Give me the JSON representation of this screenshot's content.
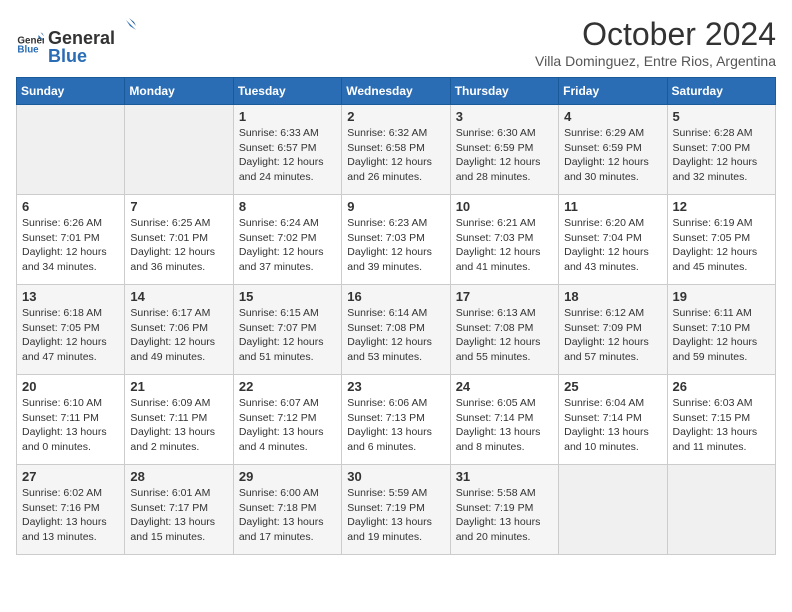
{
  "header": {
    "logo_general": "General",
    "logo_blue": "Blue",
    "month_year": "October 2024",
    "location": "Villa Dominguez, Entre Rios, Argentina"
  },
  "weekdays": [
    "Sunday",
    "Monday",
    "Tuesday",
    "Wednesday",
    "Thursday",
    "Friday",
    "Saturday"
  ],
  "weeks": [
    [
      {
        "day": "",
        "info": ""
      },
      {
        "day": "",
        "info": ""
      },
      {
        "day": "1",
        "info": "Sunrise: 6:33 AM\nSunset: 6:57 PM\nDaylight: 12 hours and 24 minutes."
      },
      {
        "day": "2",
        "info": "Sunrise: 6:32 AM\nSunset: 6:58 PM\nDaylight: 12 hours and 26 minutes."
      },
      {
        "day": "3",
        "info": "Sunrise: 6:30 AM\nSunset: 6:59 PM\nDaylight: 12 hours and 28 minutes."
      },
      {
        "day": "4",
        "info": "Sunrise: 6:29 AM\nSunset: 6:59 PM\nDaylight: 12 hours and 30 minutes."
      },
      {
        "day": "5",
        "info": "Sunrise: 6:28 AM\nSunset: 7:00 PM\nDaylight: 12 hours and 32 minutes."
      }
    ],
    [
      {
        "day": "6",
        "info": "Sunrise: 6:26 AM\nSunset: 7:01 PM\nDaylight: 12 hours and 34 minutes."
      },
      {
        "day": "7",
        "info": "Sunrise: 6:25 AM\nSunset: 7:01 PM\nDaylight: 12 hours and 36 minutes."
      },
      {
        "day": "8",
        "info": "Sunrise: 6:24 AM\nSunset: 7:02 PM\nDaylight: 12 hours and 37 minutes."
      },
      {
        "day": "9",
        "info": "Sunrise: 6:23 AM\nSunset: 7:03 PM\nDaylight: 12 hours and 39 minutes."
      },
      {
        "day": "10",
        "info": "Sunrise: 6:21 AM\nSunset: 7:03 PM\nDaylight: 12 hours and 41 minutes."
      },
      {
        "day": "11",
        "info": "Sunrise: 6:20 AM\nSunset: 7:04 PM\nDaylight: 12 hours and 43 minutes."
      },
      {
        "day": "12",
        "info": "Sunrise: 6:19 AM\nSunset: 7:05 PM\nDaylight: 12 hours and 45 minutes."
      }
    ],
    [
      {
        "day": "13",
        "info": "Sunrise: 6:18 AM\nSunset: 7:05 PM\nDaylight: 12 hours and 47 minutes."
      },
      {
        "day": "14",
        "info": "Sunrise: 6:17 AM\nSunset: 7:06 PM\nDaylight: 12 hours and 49 minutes."
      },
      {
        "day": "15",
        "info": "Sunrise: 6:15 AM\nSunset: 7:07 PM\nDaylight: 12 hours and 51 minutes."
      },
      {
        "day": "16",
        "info": "Sunrise: 6:14 AM\nSunset: 7:08 PM\nDaylight: 12 hours and 53 minutes."
      },
      {
        "day": "17",
        "info": "Sunrise: 6:13 AM\nSunset: 7:08 PM\nDaylight: 12 hours and 55 minutes."
      },
      {
        "day": "18",
        "info": "Sunrise: 6:12 AM\nSunset: 7:09 PM\nDaylight: 12 hours and 57 minutes."
      },
      {
        "day": "19",
        "info": "Sunrise: 6:11 AM\nSunset: 7:10 PM\nDaylight: 12 hours and 59 minutes."
      }
    ],
    [
      {
        "day": "20",
        "info": "Sunrise: 6:10 AM\nSunset: 7:11 PM\nDaylight: 13 hours and 0 minutes."
      },
      {
        "day": "21",
        "info": "Sunrise: 6:09 AM\nSunset: 7:11 PM\nDaylight: 13 hours and 2 minutes."
      },
      {
        "day": "22",
        "info": "Sunrise: 6:07 AM\nSunset: 7:12 PM\nDaylight: 13 hours and 4 minutes."
      },
      {
        "day": "23",
        "info": "Sunrise: 6:06 AM\nSunset: 7:13 PM\nDaylight: 13 hours and 6 minutes."
      },
      {
        "day": "24",
        "info": "Sunrise: 6:05 AM\nSunset: 7:14 PM\nDaylight: 13 hours and 8 minutes."
      },
      {
        "day": "25",
        "info": "Sunrise: 6:04 AM\nSunset: 7:14 PM\nDaylight: 13 hours and 10 minutes."
      },
      {
        "day": "26",
        "info": "Sunrise: 6:03 AM\nSunset: 7:15 PM\nDaylight: 13 hours and 11 minutes."
      }
    ],
    [
      {
        "day": "27",
        "info": "Sunrise: 6:02 AM\nSunset: 7:16 PM\nDaylight: 13 hours and 13 minutes."
      },
      {
        "day": "28",
        "info": "Sunrise: 6:01 AM\nSunset: 7:17 PM\nDaylight: 13 hours and 15 minutes."
      },
      {
        "day": "29",
        "info": "Sunrise: 6:00 AM\nSunset: 7:18 PM\nDaylight: 13 hours and 17 minutes."
      },
      {
        "day": "30",
        "info": "Sunrise: 5:59 AM\nSunset: 7:19 PM\nDaylight: 13 hours and 19 minutes."
      },
      {
        "day": "31",
        "info": "Sunrise: 5:58 AM\nSunset: 7:19 PM\nDaylight: 13 hours and 20 minutes."
      },
      {
        "day": "",
        "info": ""
      },
      {
        "day": "",
        "info": ""
      }
    ]
  ]
}
